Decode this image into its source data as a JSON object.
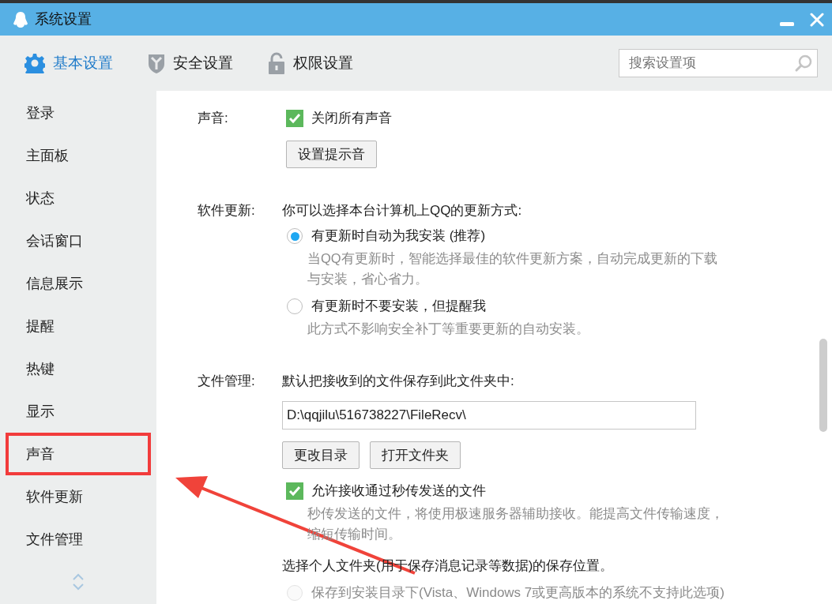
{
  "window": {
    "title": "系统设置"
  },
  "tabs": [
    {
      "label": "基本设置",
      "selected": true
    },
    {
      "label": "安全设置",
      "selected": false
    },
    {
      "label": "权限设置",
      "selected": false
    }
  ],
  "search": {
    "placeholder": "搜索设置项"
  },
  "sidebar": {
    "items": [
      {
        "label": "登录",
        "outlined": false
      },
      {
        "label": "主面板",
        "outlined": false
      },
      {
        "label": "状态",
        "outlined": false
      },
      {
        "label": "会话窗口",
        "outlined": false
      },
      {
        "label": "信息展示",
        "outlined": false
      },
      {
        "label": "提醒",
        "outlined": false
      },
      {
        "label": "热键",
        "outlined": false
      },
      {
        "label": "显示",
        "outlined": false
      },
      {
        "label": "声音",
        "outlined": true
      },
      {
        "label": "软件更新",
        "outlined": false
      },
      {
        "label": "文件管理",
        "outlined": false
      }
    ]
  },
  "sections": [
    {
      "label": "声音:",
      "items": [
        {
          "kind": "checkbox",
          "label": "关闭所有声音",
          "checked": true
        },
        {
          "kind": "button",
          "label": "设置提示音"
        }
      ]
    },
    {
      "label": "软件更新:",
      "items": [
        {
          "kind": "text",
          "label": "你可以选择本台计算机上QQ的更新方式:"
        },
        {
          "kind": "radio",
          "label": "有更新时自动为我安装 (推荐)",
          "selected": true,
          "disabled": false
        },
        {
          "kind": "description",
          "label": "当QQ有更新时，智能选择最佳的软件更新方案，自动完成更新的下载与安装，省心省力。"
        },
        {
          "kind": "radio",
          "label": "有更新时不要安装，但提醒我",
          "selected": false,
          "disabled": false
        },
        {
          "kind": "description",
          "label": "此方式不影响安全补丁等重要更新的自动安装。"
        }
      ]
    },
    {
      "label": "文件管理:",
      "items": [
        {
          "kind": "text",
          "label": "默认把接收到的文件保存到此文件夹中:"
        },
        {
          "kind": "field",
          "value": "D:\\qqjilu\\516738227\\FileRecv\\"
        },
        {
          "kind": "buttons",
          "labels": [
            "更改目录",
            "打开文件夹"
          ]
        },
        {
          "kind": "checkbox",
          "label": "允许接收通过秒传发送的文件",
          "checked": true
        },
        {
          "kind": "description",
          "label": "秒传发送的文件，将使用极速服务器辅助接收。能提高文件传输速度，缩短传输时间。"
        },
        {
          "kind": "text",
          "label": "选择个人文件夹(用于保存消息记录等数据)的保存位置。"
        },
        {
          "kind": "radio",
          "label": "保存到安装目录下(Vista、Windows 7或更高版本的系统不支持此选项)",
          "selected": false,
          "disabled": true
        }
      ]
    }
  ],
  "annotations": [
    {
      "kind": "arrow"
    }
  ]
}
